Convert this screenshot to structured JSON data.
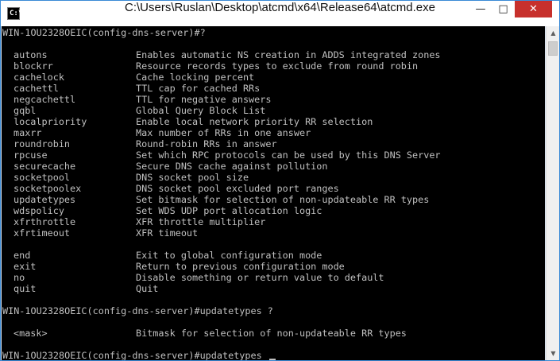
{
  "window": {
    "title": "C:\\Users\\Ruslan\\Desktop\\atcmd\\x64\\Release64\\atcmd.exe",
    "minimize_label": "—",
    "maximize_label": "□",
    "close_label": "✕",
    "icon_label": "C:\\"
  },
  "console": {
    "prompt1": "WIN-1OU2328OEIC(config-dns-server)#?",
    "commands": [
      {
        "name": "autons",
        "desc": "Enables automatic NS creation in ADDS integrated zones"
      },
      {
        "name": "blockrr",
        "desc": "Resource records types to exclude from round robin"
      },
      {
        "name": "cachelock",
        "desc": "Cache locking percent"
      },
      {
        "name": "cachettl",
        "desc": "TTL cap for cached RRs"
      },
      {
        "name": "negcachettl",
        "desc": "TTL for negative answers"
      },
      {
        "name": "gqbl",
        "desc": "Global Query Block List"
      },
      {
        "name": "localpriority",
        "desc": "Enable local network priority RR selection"
      },
      {
        "name": "maxrr",
        "desc": "Max number of RRs in one answer"
      },
      {
        "name": "roundrobin",
        "desc": "Round-robin RRs in answer"
      },
      {
        "name": "rpcuse",
        "desc": "Set which RPC protocols can be used by this DNS Server"
      },
      {
        "name": "securecache",
        "desc": "Secure DNS cache against pollution"
      },
      {
        "name": "socketpool",
        "desc": "DNS socket pool size"
      },
      {
        "name": "socketpoolex",
        "desc": "DNS socket pool excluded port ranges"
      },
      {
        "name": "updatetypes",
        "desc": "Set bitmask for selection of non-updateable RR types"
      },
      {
        "name": "wdspolicy",
        "desc": "Set WDS UDP port allocation logic"
      },
      {
        "name": "xfrthrottle",
        "desc": "XFR throttle multiplier"
      },
      {
        "name": "xfrtimeout",
        "desc": "XFR timeout"
      }
    ],
    "mode_commands": [
      {
        "name": "end",
        "desc": "Exit to global configuration mode"
      },
      {
        "name": "exit",
        "desc": "Return to previous configuration mode"
      },
      {
        "name": "no",
        "desc": "Disable something or return value to default"
      },
      {
        "name": "quit",
        "desc": "Quit"
      }
    ],
    "prompt2": "WIN-1OU2328OEIC(config-dns-server)#updatetypes ?",
    "param": {
      "name": "<mask>",
      "desc": "Bitmask for selection of non-updateable RR types"
    },
    "prompt3": "WIN-1OU2328OEIC(config-dns-server)#updatetypes "
  },
  "scrollbar": {
    "up_icon": "▲",
    "down_icon": "▼"
  }
}
